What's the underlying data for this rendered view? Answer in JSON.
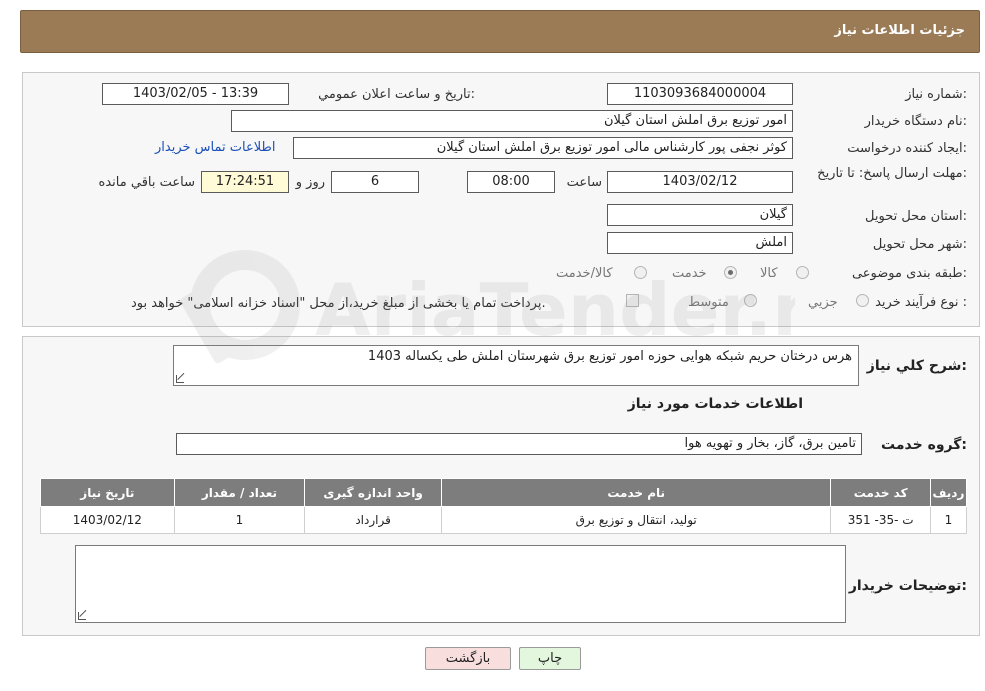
{
  "header": {
    "title": "جزئیات اطلاعات نیاز"
  },
  "form": {
    "need_number_label": "شماره نیاز:",
    "need_number": "1103093684000004",
    "announce_label": "تاریخ و ساعت اعلان عمومي:",
    "announce_value": "1403/02/05 - 13:39",
    "buyer_org_label": "نام دستگاه خريدار:",
    "buyer_org": "امور توزیع برق املش استان گیلان",
    "creator_label": "ايجاد کننده درخواست:",
    "creator": "کوثر نجفی پور کارشناس مالی امور توزیع برق املش استان گیلان",
    "contact_link": "اطلاعات تماس خريدار",
    "deadline_label": "مهلت ارسال پاسخ: تا تاريخ:",
    "deadline_date": "1403/02/12",
    "time_label": "ساعت",
    "deadline_time": "08:00",
    "days_value": "6",
    "days_label": "روز و",
    "remaining_time": "17:24:51",
    "remaining_label": "ساعت باقي مانده",
    "province_label": "استان محل تحويل:",
    "province": "گيلان",
    "city_label": "شهر محل تحويل:",
    "city": "املش",
    "category_label": "طبقه بندی موضوعی:",
    "category_options": [
      "کالا",
      "خدمت",
      "کالا/خدمت"
    ],
    "category_selected": "خدمت",
    "process_label": "نوع فرآيند خريد :",
    "process_options": [
      "جزيي",
      "متوسط"
    ],
    "payment_note": "پرداخت تمام يا بخشی از مبلغ خريد،از محل \"اسناد خزانه اسلامی\" خواهد بود."
  },
  "summary": {
    "label": "شرح کلي نياز:",
    "value": "هرس درختان حریم شبکه هوایی حوزه امور توزیع برق شهرستان املش طی یکساله 1403"
  },
  "services": {
    "section_title": "اطلاعات خدمات مورد نياز",
    "group_label": "گروه خدمت:",
    "group_value": "تامین برق، گاز، بخار و تهویه هوا",
    "columns": [
      "رديف",
      "کد خدمت",
      "نام خدمت",
      "واحد اندازه گيری",
      "تعداد / مقدار",
      "تاريخ نياز"
    ],
    "rows": [
      [
        "1",
        "ت -35- 351",
        "تولید، انتقال و توزیع برق",
        "قرارداد",
        "1",
        "1403/02/12"
      ]
    ]
  },
  "buyer_notes": {
    "label": "توضيحات خريدار:",
    "value": ""
  },
  "buttons": {
    "print": "چاپ",
    "back": "بازگشت"
  },
  "watermark": {
    "text": "AriaTender.neT"
  },
  "colors": {
    "header_bg": "#9a7b55",
    "table_header_bg": "#7d7d7d",
    "back_button_bg": "#f9dede",
    "print_button_bg": "#e3f6de"
  }
}
